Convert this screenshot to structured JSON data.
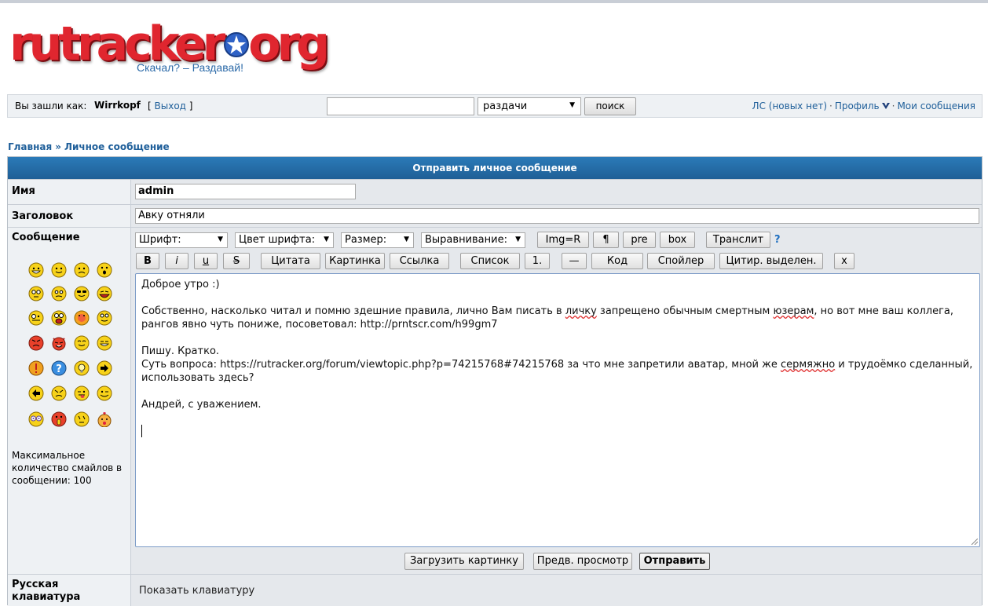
{
  "logo": {
    "part1": "rutracker",
    "part2": "org",
    "slogan": "Скачал? – Раздавай!"
  },
  "topbar": {
    "login_label": "Вы зашли как:",
    "username": "Wirrkopf",
    "logout_open": "[",
    "logout_label": "Выход",
    "logout_close": "]",
    "search_value": "",
    "search_scope": "раздачи",
    "search_button": "поиск",
    "pm_link": "ЛС (новых нет)",
    "profile_link": "Профиль",
    "my_messages_link": "Мои сообщения",
    "separator": "·"
  },
  "breadcrumb": {
    "home": "Главная",
    "separator": "»",
    "current": "Личное сообщение"
  },
  "form": {
    "header": "Отправить личное сообщение",
    "name_label": "Имя",
    "name_value": "admin",
    "subject_label": "Заголовок",
    "subject_value": "Авку отняли",
    "message_label": "Сообщение",
    "smileys_note": "Максимальное количество смайлов в сообщении: 100",
    "toolbar": {
      "font": "Шрифт:",
      "font_color": "Цвет шрифта:",
      "size": "Размер:",
      "align": "Выравнивание:",
      "img_r": "Img=R",
      "paragraph": "¶",
      "pre": "pre",
      "box": "box",
      "translit": "Транслит",
      "help": "?",
      "bold": "B",
      "italic": "i",
      "underline": "u",
      "strike": "S",
      "quote": "Цитата",
      "image": "Картинка",
      "link": "Ссылка",
      "list": "Список",
      "list_item": "1.",
      "hr": "—",
      "code": "Код",
      "spoiler": "Спойлер",
      "quote_selected": "Цитир. выделен.",
      "close_tags": "x"
    },
    "message": {
      "line1": "Доброе утро :)",
      "p2_part1": "Собственно, насколько читал и помню здешние правила, лично Вам писать в ",
      "p2_spell1": "личку",
      "p2_part2": " запрещено обычным смертным ",
      "p2_spell2": "юзерам",
      "p2_part3": ", но вот мне ваш коллега, рангов явно чуть пониже, посоветовал: http://prntscr.com/h99gm7",
      "p3_line1": "Пишу. Кратко.",
      "p3_part1": "Суть вопроса: https://rutracker.org/forum/viewtopic.php?p=74215768#74215768 за что мне запретили аватар, мной же ",
      "p3_spell": "сермяжно",
      "p3_part2": " и трудоёмко сделанный, использовать здесь?",
      "p4": "Андрей, с уважением."
    },
    "buttons": {
      "upload": "Загрузить картинку",
      "preview": "Предв. просмотр",
      "submit": "Отправить"
    },
    "keyboard_label": "Русская клавиатура",
    "keyboard_link": "Показать клавиатуру"
  },
  "colors": {
    "header_blue": "#1f5f96",
    "link_blue": "#1f5f9a",
    "logo_red": "#e0262f",
    "panel_bg": "#eef1f4"
  }
}
